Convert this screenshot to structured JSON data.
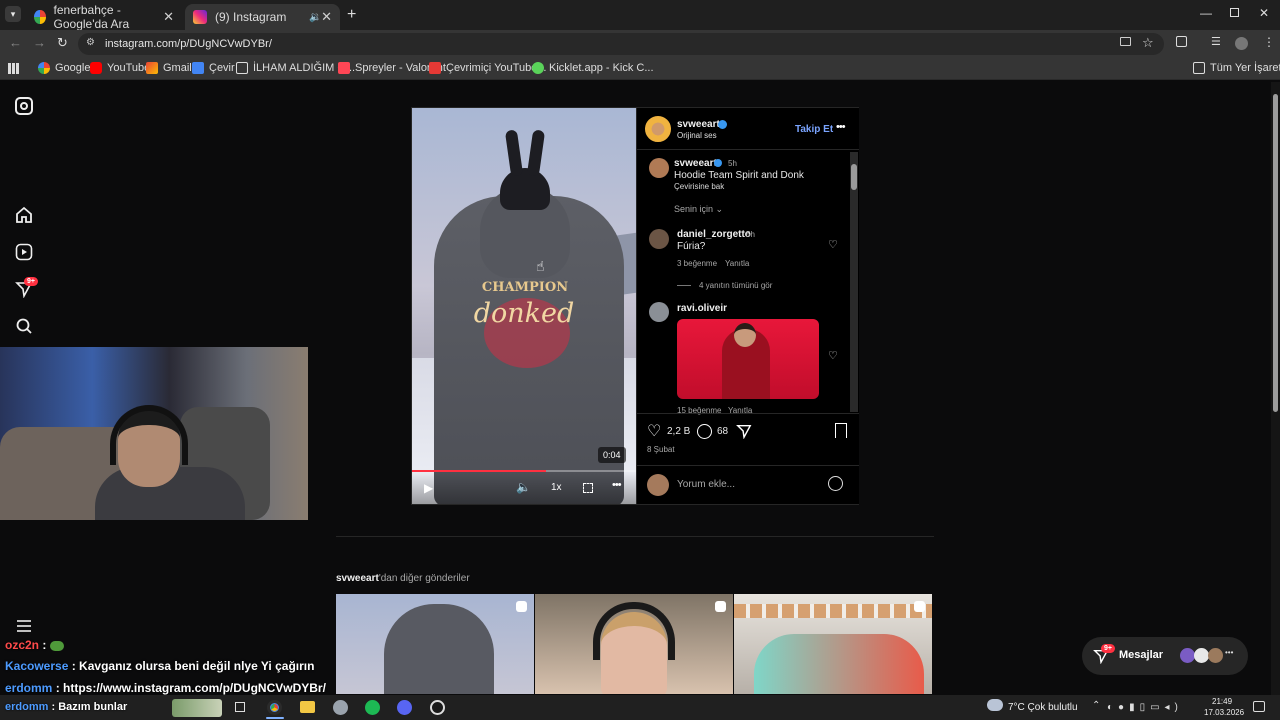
{
  "browser": {
    "tabs": [
      {
        "label": "fenerbahçe - Google'da Ara",
        "active": false
      },
      {
        "label": "(9) Instagram",
        "active": true
      }
    ],
    "url": "instagram.com/p/DUgNCVwDYBr/",
    "bookmarks": [
      "Google",
      "YouTube",
      "Gmail",
      "Çevir",
      "İLHAM ALDIĞIM G...",
      "Spreyler - Valorant",
      "Çevrimiçi YouTube...",
      "Kicklet.app - Kick C..."
    ],
    "all_bookmarks": "Tüm Yer İşaretleri"
  },
  "sidebar": {
    "notification_badge": "9+"
  },
  "post": {
    "username": "svweeart",
    "audio": "Orijinal ses",
    "follow_label": "Takip Et",
    "caption_time": "5h",
    "caption": "Hoodie Team Spirit and Donk",
    "see_translation": "Çevirisine bak",
    "filter_label": "Senin için",
    "video_time": "0:04",
    "speed": "1x",
    "hoodie_top": "CHAMPION",
    "hoodie_main": "donked",
    "comments": [
      {
        "user": "daniel_zorgetto",
        "time": "5h",
        "text": "Fúria?",
        "likes": "3 beğenme",
        "reply": "Yanıtla",
        "view_replies": "4 yanıtın tümünü gör"
      },
      {
        "user": "ravi.oliveir",
        "likes": "15 beğenme",
        "reply": "Yanıtla"
      }
    ],
    "like_count": "2,2 B",
    "comment_count": "68",
    "date": "8 Şubat",
    "comment_placeholder": "Yorum ekle..."
  },
  "more_posts": {
    "username": "svweeart",
    "suffix": "'dan diğer gönderiler"
  },
  "messages": {
    "label": "Mesajlar",
    "badge": "9+"
  },
  "chat": [
    {
      "user": "ozc2n",
      "text": ":",
      "color": "#ff4b4b"
    },
    {
      "user": "Kacowerse",
      "text": ": Kavganız olursa beni değil nlye Yi çağırın",
      "color": "#4d9bff"
    },
    {
      "user": "erdomm",
      "text": ": https://www.instagram.com/p/DUgNCVwDYBr/",
      "color": "#4d9bff"
    },
    {
      "user": "erdomm",
      "text": ": Bazım bunlar",
      "color": "#4d9bff"
    }
  ],
  "taskbar": {
    "weather": "7°C  Çok bulutlu",
    "time": "21:49",
    "date": "17.03.2026"
  },
  "colors": {
    "accent_blue": "#0095f6",
    "verified": "#3897f0",
    "progress": "#ff3040"
  },
  "video_progress": 0.6
}
